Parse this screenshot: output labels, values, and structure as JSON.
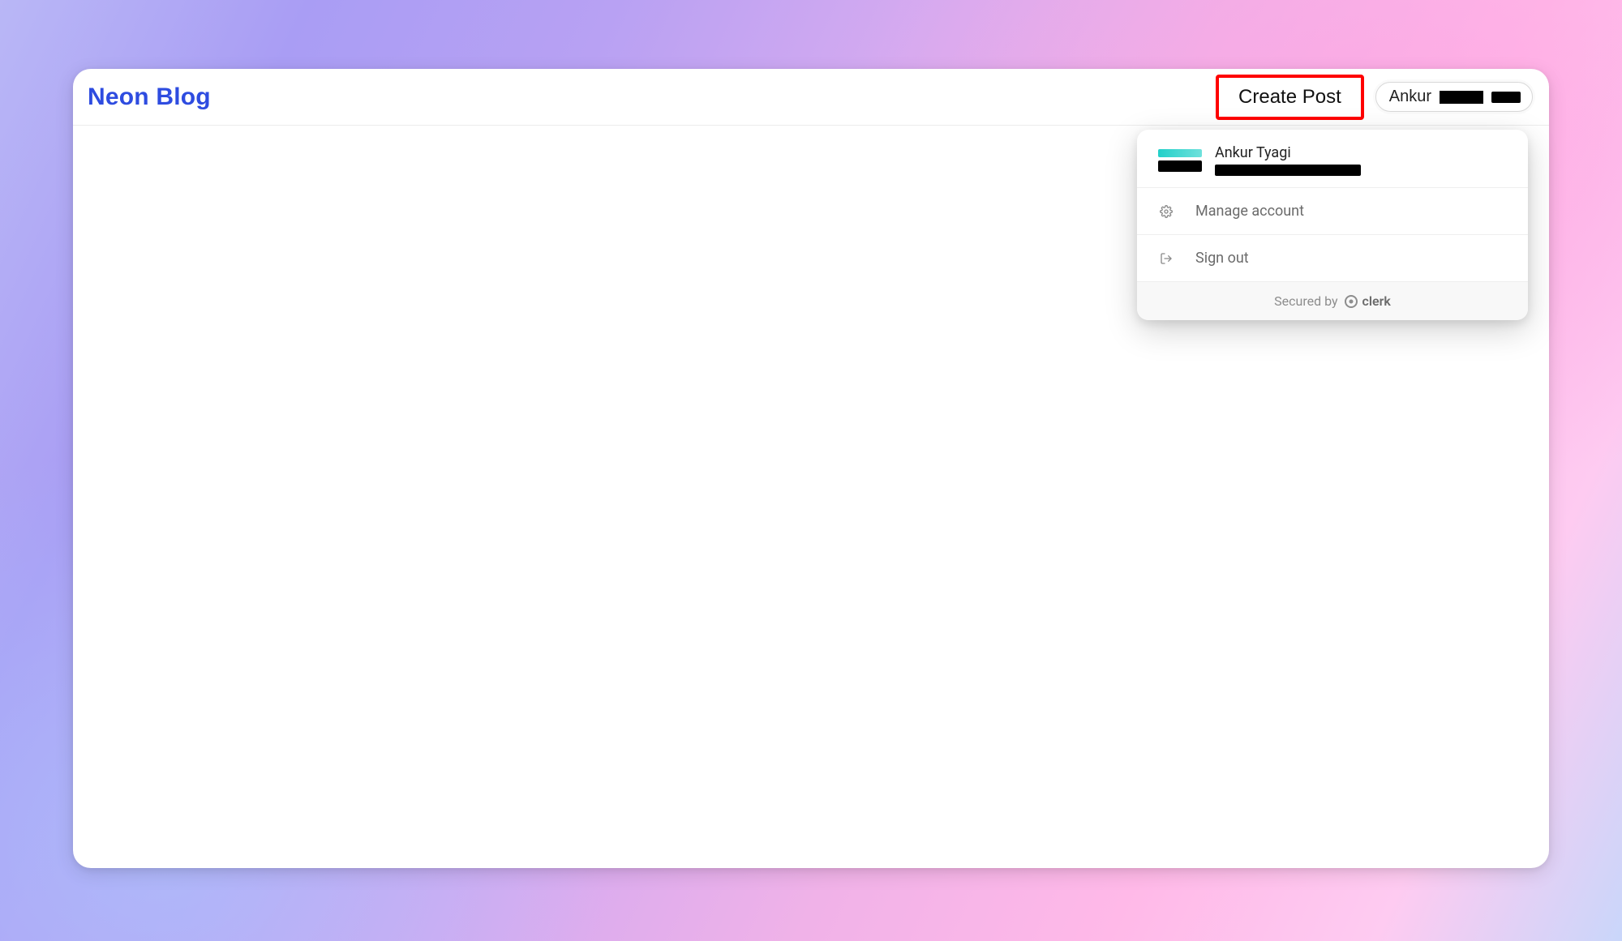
{
  "header": {
    "brand": "Neon Blog",
    "create_post_label": "Create Post",
    "user_chip_prefix": "Ankur"
  },
  "user_menu": {
    "name": "Ankur Tyagi",
    "items": [
      {
        "label": "Manage account",
        "icon": "gear-icon"
      },
      {
        "label": "Sign out",
        "icon": "sign-out-icon"
      }
    ],
    "footer_prefix": "Secured by",
    "footer_brand": "clerk"
  },
  "annotations": {
    "create_post_highlighted": true
  },
  "colors": {
    "brand_blue": "#2e4ce0",
    "highlight_red": "#ff0000"
  }
}
